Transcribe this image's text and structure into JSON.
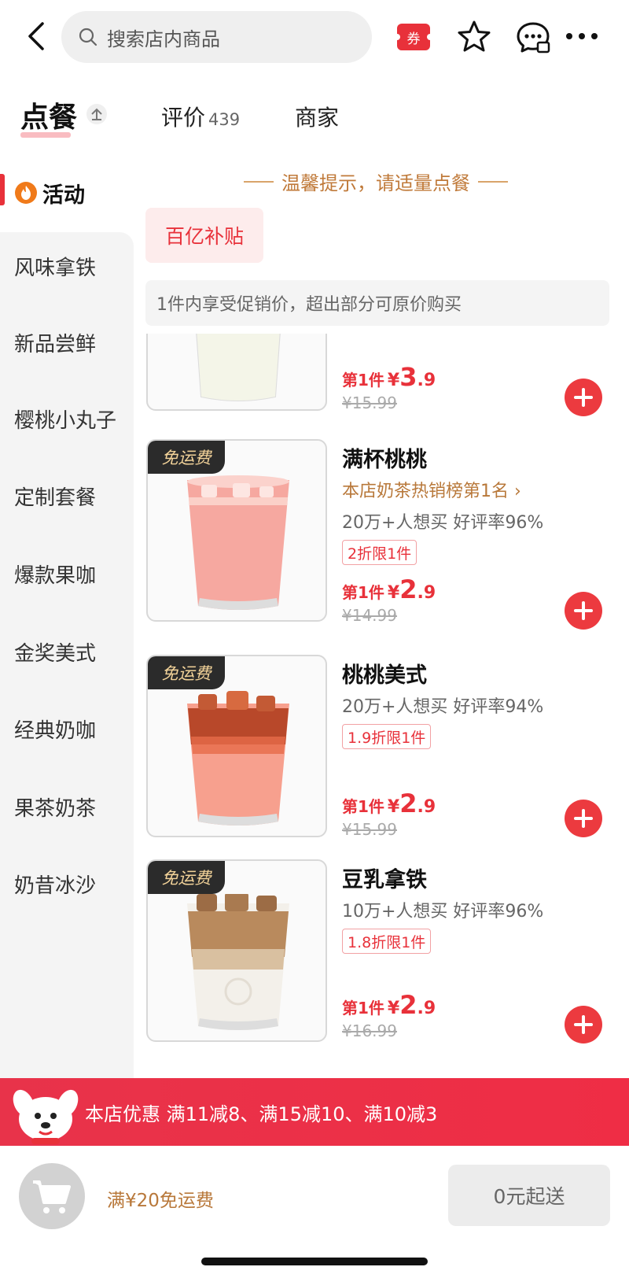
{
  "header": {
    "search_placeholder": "搜索店内商品",
    "coupon_label": "券",
    "icons": [
      "back-icon",
      "search-icon",
      "star-icon",
      "chat-icon",
      "more-icon"
    ]
  },
  "tabs": {
    "order_label": "点餐",
    "review_label": "评价",
    "review_count": "439",
    "merchant_label": "商家"
  },
  "sidebar": {
    "active_label": "活动",
    "items": [
      "风味拿铁",
      "新品尝鲜",
      "樱桃小丸子",
      "定制套餐",
      "爆款果咖",
      "金奖美式",
      "经典奶咖",
      "果茶奶茶",
      "奶昔冰沙"
    ]
  },
  "content": {
    "tip": "温馨提示，请适量点餐",
    "subsidy_tag": "百亿补贴",
    "promo_note": "1件内享受促销价，超出部分可原价购买",
    "partial_product": {
      "price_label": "第1件",
      "currency": "¥",
      "price_int": "3",
      "price_dec": ".9",
      "original_price": "¥15.99"
    },
    "products": [
      {
        "badge": "免运费",
        "name": "满杯桃桃",
        "rank": "本店奶茶热销榜第1名 ›",
        "stat": "20万+人想买  好评率96%",
        "discount": "2折限1件",
        "price_label": "第1件",
        "currency": "¥",
        "price_int": "2",
        "price_dec": ".9",
        "original_price": "¥14.99"
      },
      {
        "badge": "免运费",
        "name": "桃桃美式",
        "rank": "",
        "stat": "20万+人想买  好评率94%",
        "discount": "1.9折限1件",
        "price_label": "第1件",
        "currency": "¥",
        "price_int": "2",
        "price_dec": ".9",
        "original_price": "¥15.99"
      },
      {
        "badge": "免运费",
        "name": "豆乳拿铁",
        "rank": "",
        "stat": "10万+人想买  好评率96%",
        "discount": "1.8折限1件",
        "price_label": "第1件",
        "currency": "¥",
        "price_int": "2",
        "price_dec": ".9",
        "original_price": "¥16.99"
      }
    ]
  },
  "shop_discount": {
    "text": "本店优惠   满11减8、满15减10、满10减3"
  },
  "cart": {
    "free_shipping": "满¥20免运费",
    "min_order": "0元起送"
  },
  "colors": {
    "accent_red": "#e8313a",
    "gold_text": "#b8783a",
    "tip_orange": "#c07a3a",
    "badge_dark": "#2b2b2b"
  }
}
